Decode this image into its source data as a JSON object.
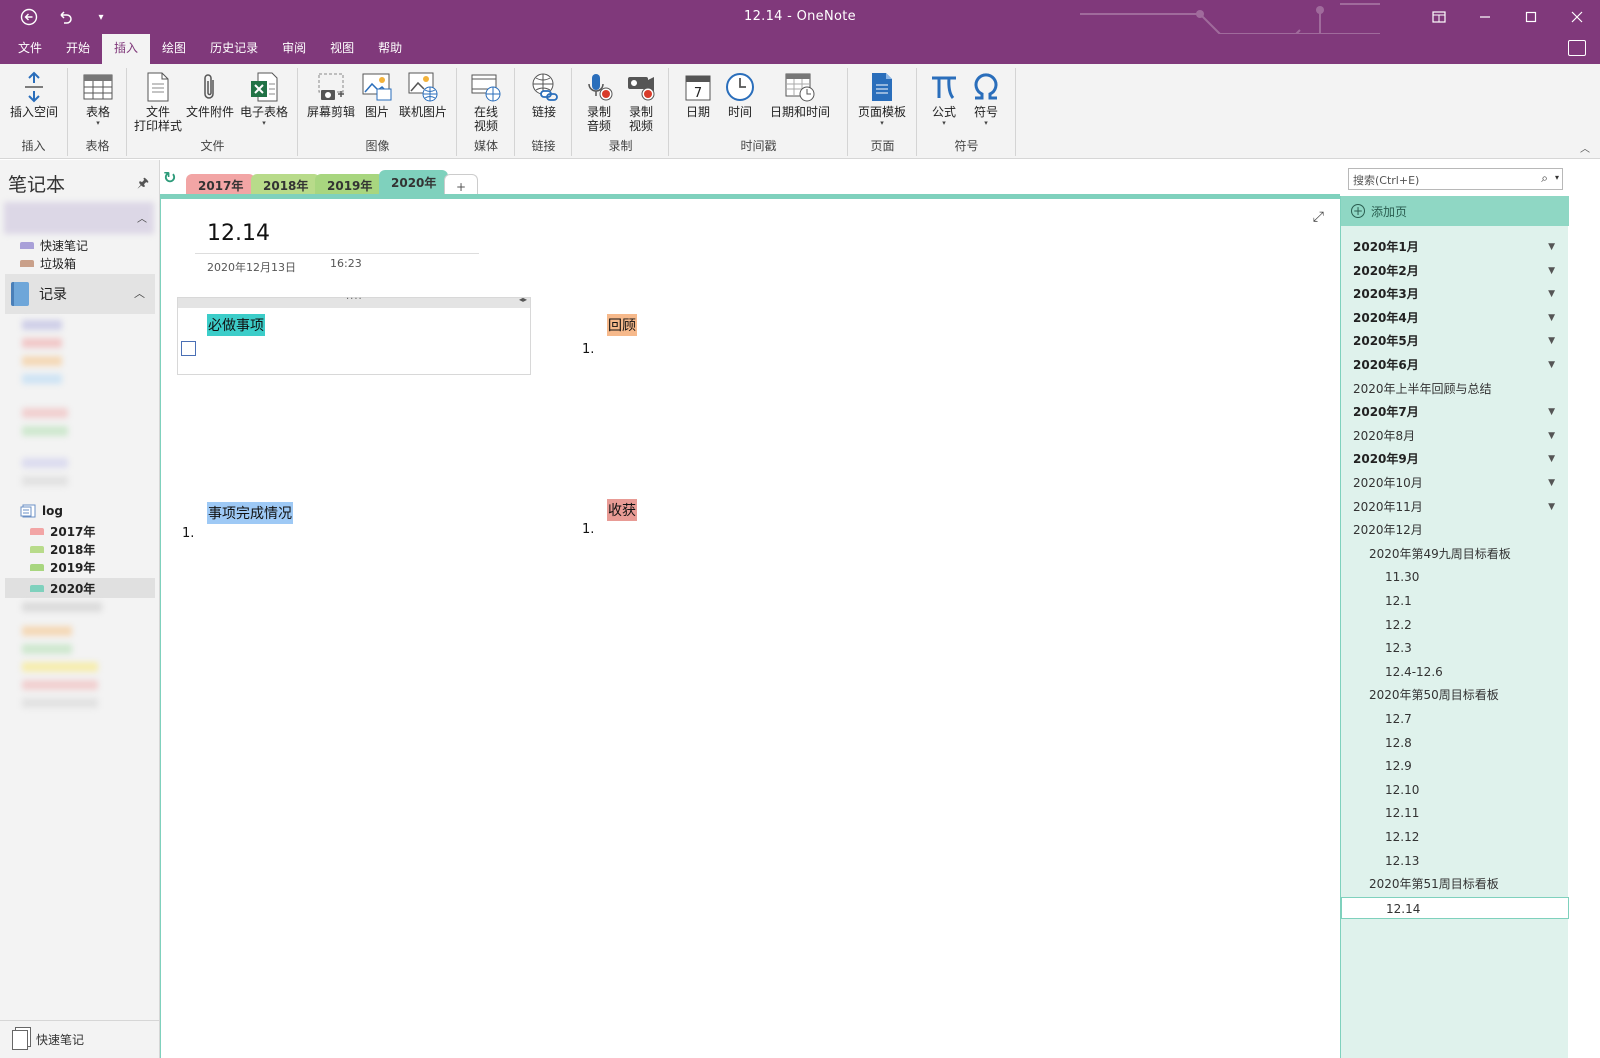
{
  "window": {
    "title": "12.14  -  OneNote",
    "qat": [
      "back-icon",
      "undo-icon",
      "customize-icon"
    ],
    "controls": [
      "restore-icon",
      "minimize-icon",
      "maximize-icon",
      "close-icon"
    ]
  },
  "menu": {
    "tabs": [
      "文件",
      "开始",
      "插入",
      "绘图",
      "历史记录",
      "审阅",
      "视图",
      "帮助"
    ],
    "active": "插入"
  },
  "ribbon": {
    "groups": {
      "insert": {
        "label": "插入",
        "buttons": [
          "插入空间"
        ]
      },
      "table": {
        "label": "表格",
        "buttons": [
          "表格"
        ]
      },
      "file": {
        "label": "文件",
        "buttons": [
          "文件",
          "打印样式",
          "文件附件",
          "电子表格"
        ]
      },
      "image": {
        "label": "图像",
        "buttons": [
          "屏幕剪辑",
          "图片",
          "联机图片"
        ]
      },
      "media": {
        "label": "媒体",
        "buttons": [
          "在线",
          "视频"
        ]
      },
      "link": {
        "label": "链接",
        "buttons": [
          "链接"
        ]
      },
      "record": {
        "label": "录制",
        "buttons": [
          "录制",
          "音频",
          "录制",
          "视频"
        ]
      },
      "timestamp": {
        "label": "时间戳",
        "buttons": [
          "日期",
          "时间",
          "日期和时间"
        ]
      },
      "page": {
        "label": "页面",
        "buttons": [
          "页面模板"
        ]
      },
      "symbol": {
        "label": "符号",
        "buttons": [
          "公式",
          "符号"
        ]
      }
    }
  },
  "leftnav": {
    "header": "笔记本",
    "items": [
      "快速笔记",
      "垃圾箱"
    ],
    "notebook": "记录",
    "log": {
      "name": "log",
      "sections": [
        "2017年",
        "2018年",
        "2019年",
        "2020年"
      ]
    },
    "quicknote": "快速笔记"
  },
  "section_tabs": [
    {
      "label": "2017年",
      "color": "#f2a5a5"
    },
    {
      "label": "2018年",
      "color": "#b8db8a"
    },
    {
      "label": "2019年",
      "color": "#a8d67f"
    },
    {
      "label": "2020年",
      "color": "#7fd1bd"
    }
  ],
  "page": {
    "title": "12.14",
    "date": "2020年12月13日",
    "time": "16:23",
    "blocks": {
      "todo": "必做事项",
      "review": "回顾",
      "completion": "事项完成情况",
      "harvest": "收获",
      "num": "1."
    },
    "colors": {
      "todo": "#3ccdc9",
      "review": "#f6b98b",
      "completion": "#9ec9f5",
      "harvest": "#e89b95"
    }
  },
  "pagelist": {
    "search_placeholder": "搜索(Ctrl+E)",
    "add_page": "添加页",
    "pages": [
      {
        "label": "2020年1月",
        "bold": true,
        "chev": true,
        "indent": 0
      },
      {
        "label": "2020年2月",
        "bold": true,
        "chev": true,
        "indent": 0
      },
      {
        "label": "2020年3月",
        "bold": true,
        "chev": true,
        "indent": 0
      },
      {
        "label": "2020年4月",
        "bold": true,
        "chev": true,
        "indent": 0
      },
      {
        "label": "2020年5月",
        "bold": true,
        "chev": true,
        "indent": 0
      },
      {
        "label": "2020年6月",
        "bold": true,
        "chev": true,
        "indent": 0
      },
      {
        "label": "2020年上半年回顾与总结",
        "bold": false,
        "chev": false,
        "indent": 0
      },
      {
        "label": "2020年7月",
        "bold": true,
        "chev": true,
        "indent": 0
      },
      {
        "label": "2020年8月",
        "bold": false,
        "chev": true,
        "indent": 0
      },
      {
        "label": "2020年9月",
        "bold": true,
        "chev": true,
        "indent": 0
      },
      {
        "label": "2020年10月",
        "bold": false,
        "chev": true,
        "indent": 0
      },
      {
        "label": "2020年11月",
        "bold": false,
        "chev": true,
        "indent": 0
      },
      {
        "label": "2020年12月",
        "bold": false,
        "chev": false,
        "indent": 0
      },
      {
        "label": "2020年第49九周目标看板",
        "bold": false,
        "chev": false,
        "indent": 1
      },
      {
        "label": "11.30",
        "bold": false,
        "chev": false,
        "indent": 2
      },
      {
        "label": "12.1",
        "bold": false,
        "chev": false,
        "indent": 2
      },
      {
        "label": "12.2",
        "bold": false,
        "chev": false,
        "indent": 2
      },
      {
        "label": "12.3",
        "bold": false,
        "chev": false,
        "indent": 2
      },
      {
        "label": "12.4-12.6",
        "bold": false,
        "chev": false,
        "indent": 2
      },
      {
        "label": "2020年第50周目标看板",
        "bold": false,
        "chev": false,
        "indent": 1
      },
      {
        "label": "12.7",
        "bold": false,
        "chev": false,
        "indent": 2
      },
      {
        "label": "12.8",
        "bold": false,
        "chev": false,
        "indent": 2
      },
      {
        "label": "12.9",
        "bold": false,
        "chev": false,
        "indent": 2
      },
      {
        "label": "12.10",
        "bold": false,
        "chev": false,
        "indent": 2
      },
      {
        "label": "12.11",
        "bold": false,
        "chev": false,
        "indent": 2
      },
      {
        "label": "12.12",
        "bold": false,
        "chev": false,
        "indent": 2
      },
      {
        "label": "12.13",
        "bold": false,
        "chev": false,
        "indent": 2
      },
      {
        "label": "2020年第51周目标看板",
        "bold": false,
        "chev": false,
        "indent": 1
      },
      {
        "label": "12.14",
        "bold": false,
        "chev": false,
        "indent": 2,
        "selected": true
      }
    ]
  }
}
